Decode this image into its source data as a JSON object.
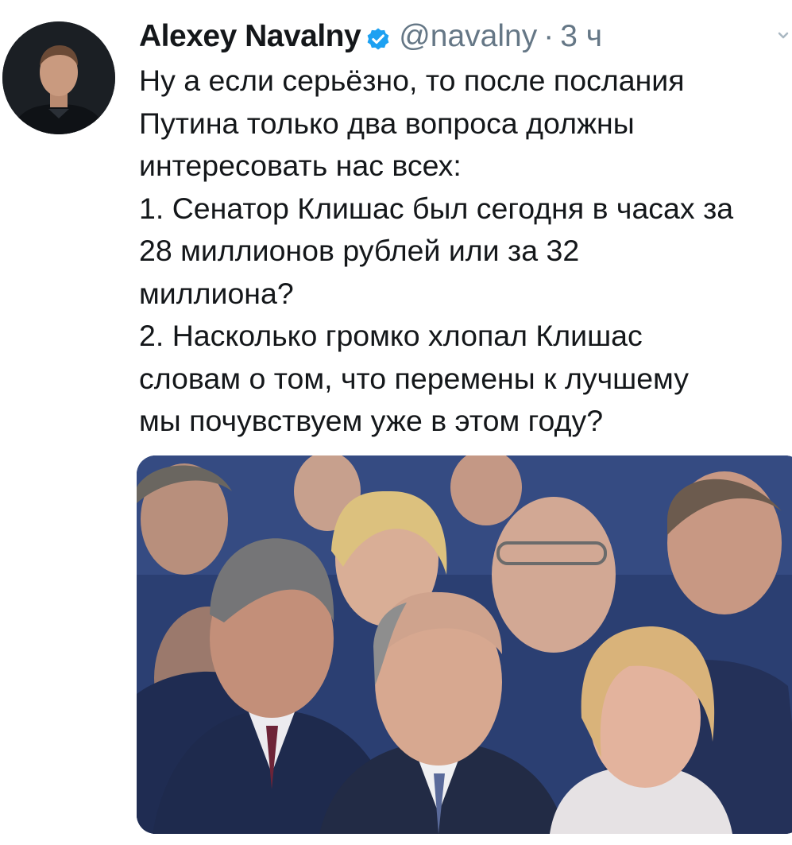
{
  "tweet": {
    "author": {
      "display_name": "Alexey Navalny",
      "verified": true,
      "handle": "@navalny",
      "separator": "·",
      "time": "3 ч"
    },
    "icons": {
      "avatar": "profile-photo",
      "verified": "verified-badge-icon",
      "menu": "chevron-down-icon"
    },
    "colors": {
      "text": "#14171a",
      "secondary": "#657786",
      "verified": "#1da1f2"
    },
    "text_lines": [
      "Ну а если серьёзно, то после послания",
      "Путина только два вопроса должны",
      "интересовать нас всех:",
      "1. Сенатор Клишас был сегодня в часах за",
      "28 миллионов рублей или за 32",
      "миллиона?",
      "2. Насколько громко хлопал Клишас",
      "словам о том, что перемены к лучшему",
      "мы почувствуем уже в этом году?"
    ],
    "media": {
      "type": "photo"
    }
  }
}
